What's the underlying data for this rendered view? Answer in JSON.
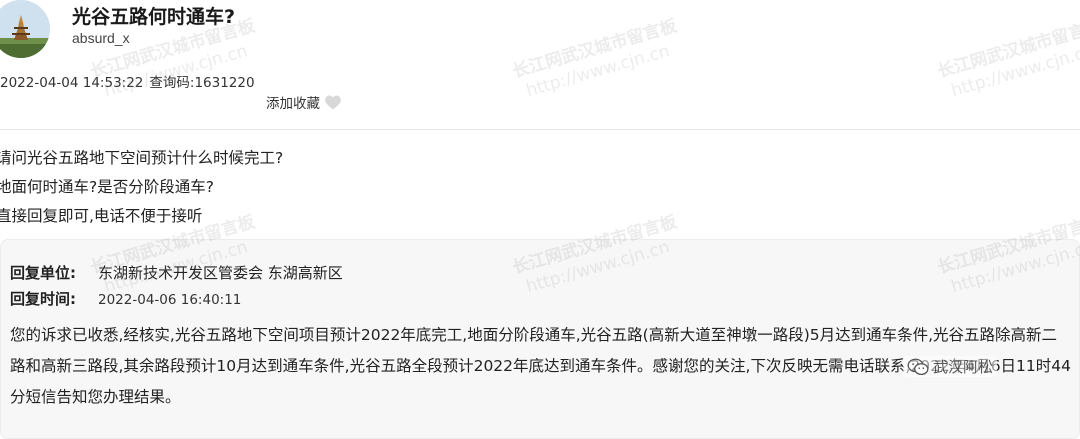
{
  "post": {
    "title": "光谷五路何时通车?",
    "author": "absurd_x",
    "datetime": "2022-04-04 14:53:22",
    "query_code_label": "查询码:",
    "query_code": "1631220",
    "favorite_label": "添加收藏"
  },
  "question": {
    "lines": [
      "请问光谷五路地下空间预计什么时候完工?",
      "地面何时通车?是否分阶段通车?",
      "直接回复即可,电话不便于接听"
    ]
  },
  "reply": {
    "unit_label": "回复单位:",
    "unit_value": "东湖新技术开发区管委会 东湖高新区",
    "time_label": "回复时间:",
    "time_value": "2022-04-06 16:40:11",
    "body": "您的诉求已收悉,经核实,光谷五路地下空间项目预计2022年底完工,地面分阶段通车,光谷五路(高新大道至神墩一路段)5月达到通车条件,光谷五路除高新二路和高新三路段,其余路段预计10月达到通车条件,光谷五路全段预计2022年底达到通车条件。感谢您的关注,下次反映无需电话联系,2022年4月6日11时44分短信告知您办理结果。"
  },
  "watermark": {
    "text": "长江网武汉城市留言板",
    "url": "http://www.cjn.cn"
  },
  "overlay": {
    "wechat_account": "武汉阿松"
  },
  "colors": {
    "text": "#222222",
    "reply_background": "#f7f7f7",
    "watermark": "#969696"
  }
}
